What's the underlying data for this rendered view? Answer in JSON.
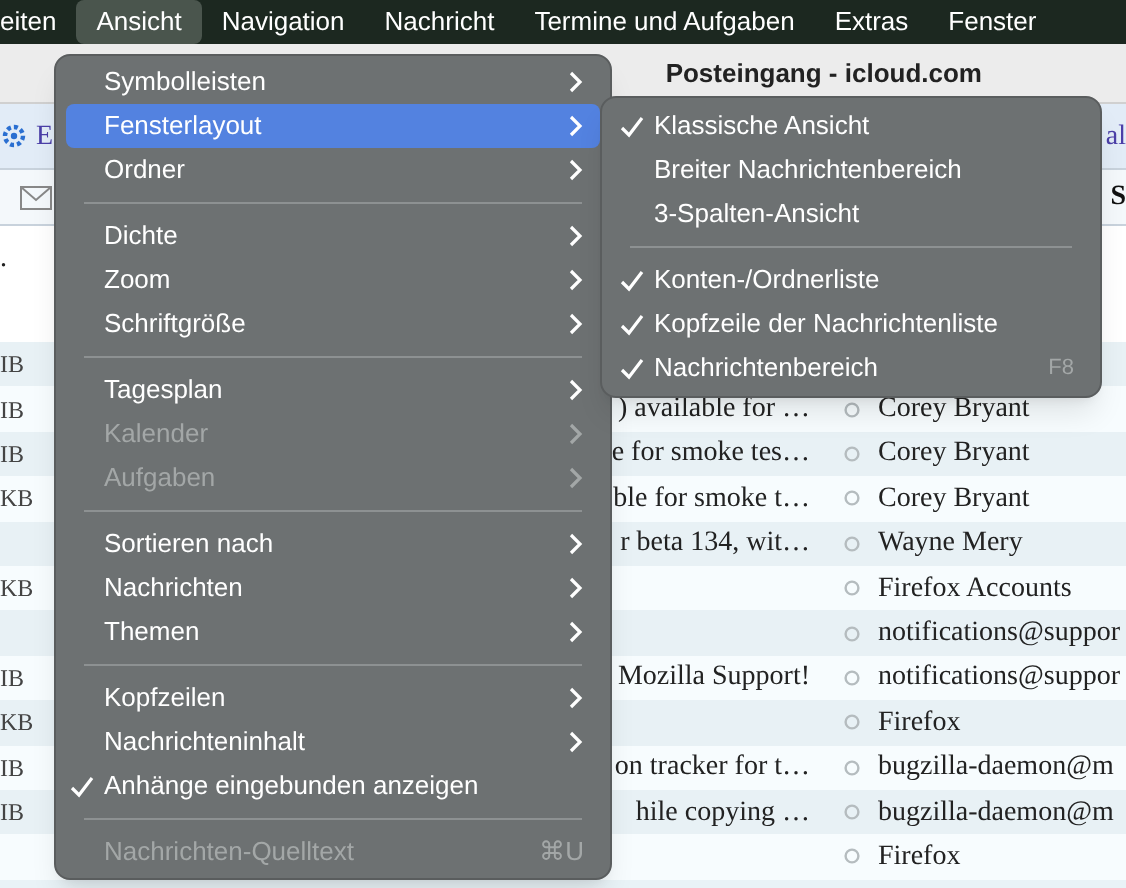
{
  "menu_bar": [
    {
      "label": "eiten",
      "selected": false
    },
    {
      "label": "Ansicht",
      "selected": true
    },
    {
      "label": "Navigation",
      "selected": false
    },
    {
      "label": "Nachricht",
      "selected": false
    },
    {
      "label": "Termine und Aufgaben",
      "selected": false
    },
    {
      "label": "Extras",
      "selected": false
    },
    {
      "label": "Fenster",
      "selected": false
    }
  ],
  "window": {
    "title": "Posteingang - icloud.com",
    "toolbar": {
      "left_text": "E",
      "right_text": "al"
    },
    "header": {
      "right_text": "S"
    },
    "top_row_text": ".",
    "rows": [
      {
        "size": "IB",
        "subject": "",
        "sender": ""
      },
      {
        "size": "IB",
        "subject": ") available for …",
        "sender": "Corey Bryant"
      },
      {
        "size": "IB",
        "subject": "e for smoke tes…",
        "sender": "Corey Bryant"
      },
      {
        "size": "KB",
        "subject": "ble for smoke t…",
        "sender": "Corey Bryant"
      },
      {
        "size": "",
        "subject": "r beta 134, wit…",
        "sender": "Wayne Mery"
      },
      {
        "size": "KB",
        "subject": "",
        "sender": "Firefox Accounts"
      },
      {
        "size": "",
        "subject": "",
        "sender": "notifications@suppor"
      },
      {
        "size": "IB",
        "subject": "Mozilla Support!",
        "sender": "notifications@suppor"
      },
      {
        "size": "KB",
        "subject": "",
        "sender": "Firefox"
      },
      {
        "size": "IB",
        "subject": "on tracker for t…",
        "sender": "bugzilla-daemon@m"
      },
      {
        "size": "IB",
        "subject": "hile copying …",
        "sender": "bugzilla-daemon@m"
      },
      {
        "size": "",
        "subject": "",
        "sender": "Firefox"
      }
    ]
  },
  "menu": {
    "items": [
      {
        "kind": "item",
        "label": "Symbolleisten",
        "submenu": true,
        "disabled": false,
        "checked": false,
        "selected": false
      },
      {
        "kind": "item",
        "label": "Fensterlayout",
        "submenu": true,
        "disabled": false,
        "checked": false,
        "selected": true
      },
      {
        "kind": "item",
        "label": "Ordner",
        "submenu": true,
        "disabled": false,
        "checked": false,
        "selected": false
      },
      {
        "kind": "separator"
      },
      {
        "kind": "item",
        "label": "Dichte",
        "submenu": true,
        "disabled": false,
        "checked": false,
        "selected": false
      },
      {
        "kind": "item",
        "label": "Zoom",
        "submenu": true,
        "disabled": false,
        "checked": false,
        "selected": false
      },
      {
        "kind": "item",
        "label": "Schriftgröße",
        "submenu": true,
        "disabled": false,
        "checked": false,
        "selected": false
      },
      {
        "kind": "separator"
      },
      {
        "kind": "item",
        "label": "Tagesplan",
        "submenu": true,
        "disabled": false,
        "checked": false,
        "selected": false
      },
      {
        "kind": "item",
        "label": "Kalender",
        "submenu": true,
        "disabled": true,
        "checked": false,
        "selected": false
      },
      {
        "kind": "item",
        "label": "Aufgaben",
        "submenu": true,
        "disabled": true,
        "checked": false,
        "selected": false
      },
      {
        "kind": "separator"
      },
      {
        "kind": "item",
        "label": "Sortieren nach",
        "submenu": true,
        "disabled": false,
        "checked": false,
        "selected": false
      },
      {
        "kind": "item",
        "label": "Nachrichten",
        "submenu": true,
        "disabled": false,
        "checked": false,
        "selected": false
      },
      {
        "kind": "item",
        "label": "Themen",
        "submenu": true,
        "disabled": false,
        "checked": false,
        "selected": false
      },
      {
        "kind": "separator"
      },
      {
        "kind": "item",
        "label": "Kopfzeilen",
        "submenu": true,
        "disabled": false,
        "checked": false,
        "selected": false
      },
      {
        "kind": "item",
        "label": "Nachrichteninhalt",
        "submenu": true,
        "disabled": false,
        "checked": false,
        "selected": false
      },
      {
        "kind": "item",
        "label": "Anhänge eingebunden anzeigen",
        "submenu": false,
        "disabled": false,
        "checked": true,
        "selected": false
      },
      {
        "kind": "separator"
      },
      {
        "kind": "item",
        "label": "Nachrichten-Quelltext",
        "submenu": false,
        "disabled": true,
        "checked": false,
        "selected": false,
        "shortcut": "⌘U"
      }
    ]
  },
  "submenu": {
    "items": [
      {
        "kind": "item",
        "label": "Klassische Ansicht",
        "checked": true
      },
      {
        "kind": "item",
        "label": "Breiter Nachrichtenbereich",
        "checked": false
      },
      {
        "kind": "item",
        "label": "3-Spalten-Ansicht",
        "checked": false
      },
      {
        "kind": "separator"
      },
      {
        "kind": "item",
        "label": "Konten-/Ordnerliste",
        "checked": true
      },
      {
        "kind": "item",
        "label": "Kopfzeile der Nachrichtenliste",
        "checked": true
      },
      {
        "kind": "item",
        "label": "Nachrichtenbereich",
        "checked": true,
        "shortcut": "F8"
      }
    ]
  }
}
